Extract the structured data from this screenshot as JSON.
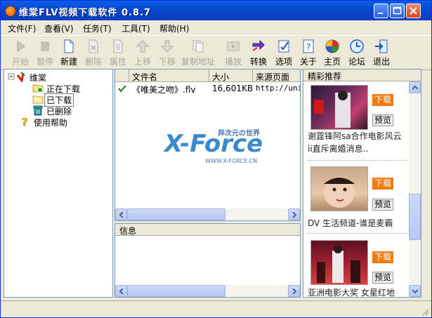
{
  "window": {
    "title": "维棠FLV视频下载软件 0.8.7"
  },
  "menu": [
    {
      "label": "文件(F)"
    },
    {
      "label": "查看(V)"
    },
    {
      "label": "任务(T)"
    },
    {
      "label": "工具(T)"
    },
    {
      "label": "帮助(H)"
    }
  ],
  "toolbar": [
    {
      "label": "开始",
      "icon": "play-arrow-icon",
      "enabled": false
    },
    {
      "label": "暂停",
      "icon": "pause-icon",
      "enabled": false
    },
    {
      "label": "新建",
      "icon": "new-file-icon",
      "enabled": true
    },
    {
      "label": "删除",
      "icon": "delete-file-icon",
      "enabled": false
    },
    {
      "label": "属性",
      "icon": "properties-icon",
      "enabled": false
    },
    {
      "label": "上移",
      "icon": "move-up-icon",
      "enabled": false
    },
    {
      "label": "下移",
      "icon": "move-down-icon",
      "enabled": false
    },
    {
      "label": "复制地址",
      "icon": "copy-url-icon",
      "enabled": false
    },
    {
      "label": "播放",
      "icon": "play-media-icon",
      "enabled": false
    },
    {
      "label": "转换",
      "icon": "convert-icon",
      "enabled": true
    },
    {
      "label": "选项",
      "icon": "options-icon",
      "enabled": true
    },
    {
      "label": "关于",
      "icon": "about-icon",
      "enabled": true
    },
    {
      "label": "主页",
      "icon": "homepage-icon",
      "enabled": true
    },
    {
      "label": "论坛",
      "icon": "forum-icon",
      "enabled": true
    },
    {
      "label": "退出",
      "icon": "exit-icon",
      "enabled": true
    }
  ],
  "tree": {
    "root": "维棠",
    "children": [
      {
        "label": "正在下载",
        "icon": "downloading-folder-icon"
      },
      {
        "label": "已下载",
        "icon": "downloaded-folder-icon"
      },
      {
        "label": "已删除",
        "icon": "trash-icon"
      }
    ],
    "help": "使用帮助"
  },
  "files": {
    "columns": [
      "文件名",
      "大小",
      "来源页面"
    ],
    "rows": [
      {
        "name": "《唯美之吻》.flv",
        "size": "16,601KB",
        "source": "http://unic"
      }
    ]
  },
  "info": {
    "title": "信息"
  },
  "recommend": {
    "title": "精彩推荐",
    "download_label": "下载",
    "preview_label": "预览",
    "items": [
      {
        "caption": "谢霆锋阿sa合作电影风云"
      },
      {
        "caption": "ii直斥离婚消息.."
      },
      {
        "caption": "DV 生活频道-谁是麦霸"
      },
      {
        "caption": "亚洲电影大奖 女星红地"
      }
    ]
  },
  "watermark": {
    "logo": "X-Force",
    "tagline": "异次元の世界",
    "url": "WWW.X-FORCE.CN"
  },
  "colors": {
    "title_bar": "#0a4fd6",
    "download_button": "#f47a10",
    "check": "#1f7a1f"
  }
}
